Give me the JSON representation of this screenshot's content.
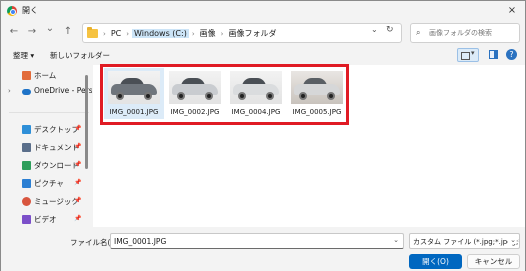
{
  "window": {
    "title": "開く",
    "close_icon": "×"
  },
  "nav": {
    "back": "←",
    "forward": "→",
    "recent": "⌄",
    "up": "↑"
  },
  "address": {
    "crumbs": [
      "PC",
      "Windows (C:)",
      "画像",
      "画像フォルダ"
    ],
    "chevron": "⌄",
    "refresh": "↻"
  },
  "search": {
    "placeholder": "画像フォルダの検索",
    "icon": "⌕"
  },
  "toolbar": {
    "organize": "整理 ▾",
    "new_folder": "新しいフォルダー",
    "help": "?"
  },
  "sidebar": {
    "items": [
      {
        "label": "ホーム",
        "icon": "home-icon",
        "color": "#e26b3a",
        "chev": ""
      },
      {
        "label": "OneDrive - Perso",
        "icon": "onedrive-icon",
        "color": "#1e73c8",
        "chev": "›"
      },
      {
        "label": "デスクトップ",
        "icon": "desktop-icon",
        "color": "#2e8fd8",
        "chev": ""
      },
      {
        "label": "ドキュメント",
        "icon": "documents-icon",
        "color": "#5a6e8a",
        "chev": ""
      },
      {
        "label": "ダウンロード",
        "icon": "downloads-icon",
        "color": "#2e9e5b",
        "chev": ""
      },
      {
        "label": "ピクチャ",
        "icon": "pictures-icon",
        "color": "#2b7fd3",
        "chev": ""
      },
      {
        "label": "ミュージック",
        "icon": "music-icon",
        "color": "#d8553e",
        "chev": ""
      },
      {
        "label": "ビデオ",
        "icon": "videos-icon",
        "color": "#7b4fc9",
        "chev": ""
      }
    ],
    "pin": "📌"
  },
  "files": [
    {
      "name": "IMG_0001.JPG",
      "car_color": "#6f757c",
      "bg": "light",
      "selected": true
    },
    {
      "name": "IMG_0002.JPG",
      "car_color": "#c9ccd0",
      "bg": "light",
      "selected": false
    },
    {
      "name": "IMG_0004.JPG",
      "car_color": "#dadcde",
      "bg": "light",
      "selected": false
    },
    {
      "name": "IMG_0005.JPG",
      "car_color": "#d6d7d8",
      "bg": "dark",
      "selected": false
    }
  ],
  "footer": {
    "filename_label": "ファイル名(N):",
    "filename_value": "IMG_0001.JPG",
    "filter_value": "カスタム ファイル (*.jpg;*.jpeg;*.png)",
    "open_label": "開く(O)",
    "cancel_label": "キャンセル",
    "chevron": "⌄"
  },
  "colors": {
    "accent": "#0067c0",
    "highlight_box": "#e01b24"
  }
}
